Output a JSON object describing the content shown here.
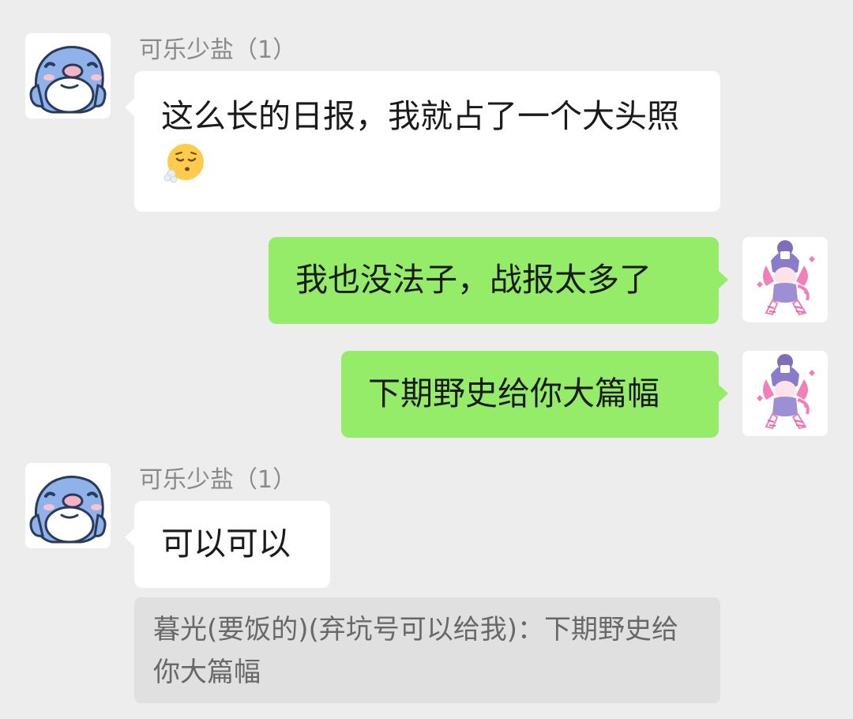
{
  "messages": [
    {
      "sender": "可乐少盐（1）",
      "side": "left",
      "text": "这么长的日报，我就占了一个大头照",
      "emoji": "exhaling-face-emoji"
    },
    {
      "side": "right",
      "text": "我也没法子，战报太多了"
    },
    {
      "side": "right",
      "text": "下期野史给你大篇幅"
    },
    {
      "sender": "可乐少盐（1）",
      "side": "left",
      "text": "可以可以",
      "quote": "暮光(要饭的)(弃坑号可以给我)：下期野史给你大篇幅"
    }
  ],
  "colors": {
    "background": "#ededed",
    "incoming_bubble": "#ffffff",
    "outgoing_bubble": "#95ec69",
    "quote_background": "#e0e0e0",
    "sender_name": "#8a8a8a"
  },
  "icons": {
    "incoming_avatar": "blue-seal-avatar-icon",
    "outgoing_avatar": "anime-girl-avatar-icon"
  }
}
